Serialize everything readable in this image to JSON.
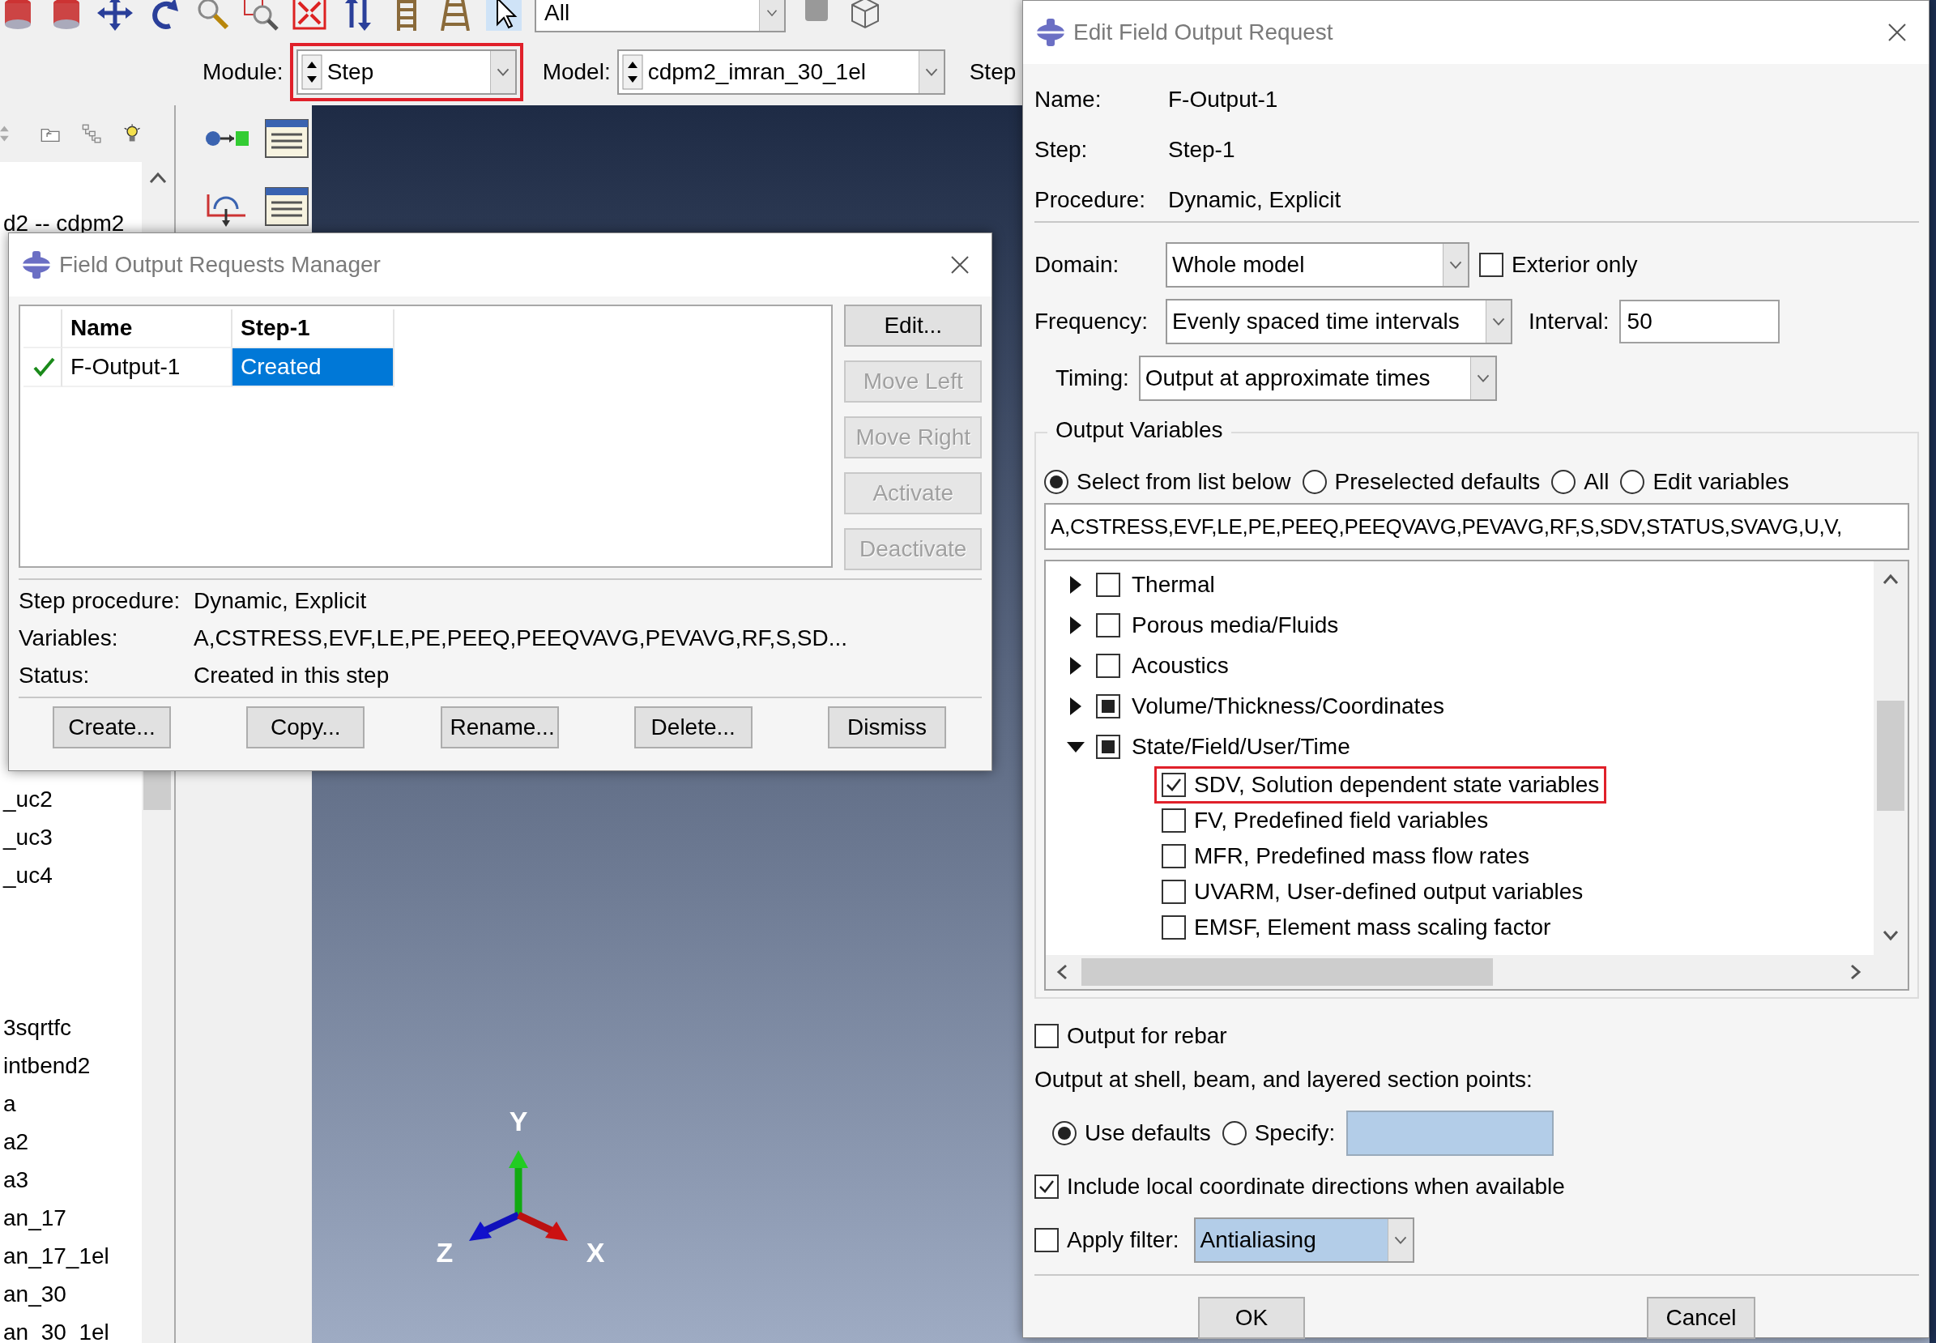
{
  "toolbar": {
    "selection_filter": "All"
  },
  "context_bar": {
    "module_label": "Module:",
    "module": "Step",
    "module_highlighted": true,
    "model_label": "Model:",
    "model": "cdpm2_imran_30_1el",
    "step_label": "Step"
  },
  "model_tree": {
    "items": [
      {
        "label": "d2 -- cdpm2"
      },
      {
        "label": "_uc2"
      },
      {
        "label": "_uc3"
      },
      {
        "label": "_uc4"
      },
      {
        "label": "3sqrtfc"
      },
      {
        "label": "intbend2"
      },
      {
        "label": "a"
      },
      {
        "label": "a2"
      },
      {
        "label": "a3"
      },
      {
        "label": "an_17"
      },
      {
        "label": "an_17_1el"
      },
      {
        "label": "an_30"
      },
      {
        "label": "an_30_1el"
      }
    ]
  },
  "viewport": {
    "axes": [
      "Y",
      "Z",
      "X"
    ]
  },
  "manager_dialog": {
    "title": "Field Output Requests Manager",
    "columns": [
      "Name",
      "Step-1"
    ],
    "rows": [
      {
        "name": "F-Output-1",
        "active": true,
        "status": "Created",
        "selected": true
      }
    ],
    "side_buttons": [
      {
        "label": "Edit...",
        "disabled": false
      },
      {
        "label": "Move Left",
        "disabled": true
      },
      {
        "label": "Move Right",
        "disabled": true
      },
      {
        "label": "Activate",
        "disabled": true
      },
      {
        "label": "Deactivate",
        "disabled": true
      }
    ],
    "info": [
      {
        "label": "Step procedure:",
        "value": "Dynamic, Explicit"
      },
      {
        "label": "Variables:",
        "value": "A,CSTRESS,EVF,LE,PE,PEEQ,PEEQVAVG,PEVAVG,RF,S,SD..."
      },
      {
        "label": "Status:",
        "value": "Created in this step"
      }
    ],
    "buttons": [
      "Create...",
      "Copy...",
      "Rename...",
      "Delete...",
      "Dismiss"
    ]
  },
  "edit_dialog": {
    "title": "Edit Field Output Request",
    "info": [
      {
        "label": "Name:",
        "value": "F-Output-1"
      },
      {
        "label": "Step:",
        "value": "Step-1"
      },
      {
        "label": "Procedure:",
        "value": "Dynamic, Explicit"
      }
    ],
    "domain": {
      "label": "Domain:",
      "value": "Whole model"
    },
    "exterior_only": {
      "label": "Exterior only",
      "checked": false
    },
    "frequency": {
      "label": "Frequency:",
      "value": "Evenly spaced time intervals"
    },
    "interval": {
      "label": "Interval:",
      "value": "50"
    },
    "timing": {
      "label": "Timing:",
      "value": "Output at approximate times"
    },
    "output_variables": {
      "title": "Output Variables",
      "modes": [
        {
          "label": "Select from list below",
          "selected": true
        },
        {
          "label": "Preselected defaults",
          "selected": false
        },
        {
          "label": "All",
          "selected": false
        },
        {
          "label": "Edit variables",
          "selected": false
        }
      ],
      "variables_text": "A,CSTRESS,EVF,LE,PE,PEEQ,PEEQVAVG,PEVAVG,RF,S,SDV,STATUS,SVAVG,U,V,",
      "tree": [
        {
          "label": "Thermal",
          "checked": false,
          "partial": false,
          "expanded": false
        },
        {
          "label": "Porous media/Fluids",
          "checked": false,
          "partial": false,
          "expanded": false
        },
        {
          "label": "Acoustics",
          "checked": false,
          "partial": false,
          "expanded": false
        },
        {
          "label": "Volume/Thickness/Coordinates",
          "checked": false,
          "partial": true,
          "expanded": false
        },
        {
          "label": "State/Field/User/Time",
          "checked": false,
          "partial": true,
          "expanded": true,
          "children": [
            {
              "label": "SDV, Solution dependent state variables",
              "checked": true,
              "highlighted": true
            },
            {
              "label": "FV, Predefined field variables",
              "checked": false,
              "highlighted": false
            },
            {
              "label": "MFR, Predefined mass flow rates",
              "checked": false,
              "highlighted": false
            },
            {
              "label": "UVARM, User-defined output variables",
              "checked": false,
              "highlighted": false
            },
            {
              "label": "EMSF, Element mass scaling factor",
              "checked": false,
              "highlighted": false
            }
          ]
        }
      ]
    },
    "rebar": {
      "label": "Output for rebar",
      "checked": false
    },
    "section_points": {
      "label": "Output at shell, beam, and layered section points:",
      "options": [
        {
          "label": "Use defaults",
          "selected": true
        },
        {
          "label": "Specify:",
          "selected": false
        }
      ]
    },
    "local_coords": {
      "label": "Include local coordinate directions when available",
      "checked": true
    },
    "filter": {
      "label": "Apply filter:",
      "checked": false,
      "value": "Antialiasing"
    },
    "buttons": [
      "OK",
      "Cancel"
    ]
  }
}
